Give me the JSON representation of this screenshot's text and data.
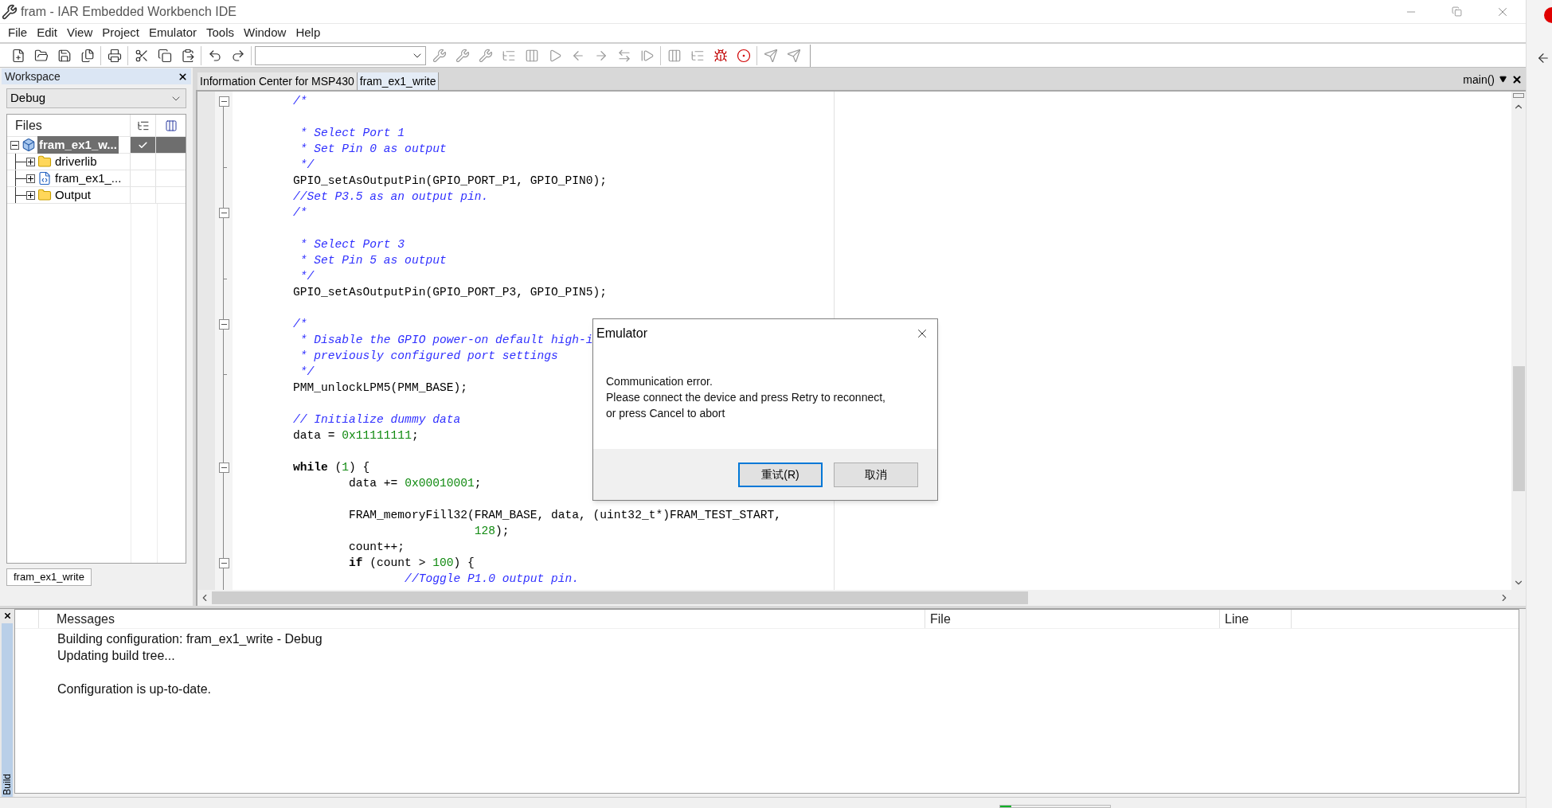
{
  "window": {
    "title": "fram - IAR Embedded Workbench IDE"
  },
  "menu": [
    "File",
    "Edit",
    "View",
    "Project",
    "Emulator",
    "Tools",
    "Window",
    "Help"
  ],
  "workspace": {
    "title": "Workspace",
    "configuration": "Debug",
    "files_header": "Files",
    "tree": [
      {
        "label": "fram_ex1_w...",
        "kind": "project",
        "selected": true,
        "checked": true,
        "expanded": true,
        "children": [
          {
            "label": "driverlib",
            "kind": "folder",
            "selected": false,
            "checked": false,
            "expanded": false
          },
          {
            "label": "fram_ex1_...",
            "kind": "cfile",
            "selected": false,
            "checked": false,
            "expanded": false
          },
          {
            "label": "Output",
            "kind": "folder",
            "selected": false,
            "checked": false,
            "expanded": false
          }
        ]
      }
    ],
    "bottom_tab": "fram_ex1_write"
  },
  "editor": {
    "tabs": [
      {
        "label": "Information Center for MSP430",
        "selected": false
      },
      {
        "label": "fram_ex1_write",
        "selected": true
      }
    ],
    "function": "main()",
    "lines": [
      {
        "kind": "fold_start",
        "segments": [
          {
            "kind": "comment",
            "text": "/*"
          }
        ]
      },
      {
        "kind": "plain"
      },
      {
        "kind": "plain",
        "segments": [
          {
            "kind": "comment",
            "text": " * Select Port 1"
          }
        ]
      },
      {
        "kind": "plain",
        "segments": [
          {
            "kind": "comment",
            "text": " * Set Pin 0 as output"
          }
        ]
      },
      {
        "kind": "fold_end",
        "segments": [
          {
            "kind": "comment",
            "text": " */"
          }
        ]
      },
      {
        "kind": "plain",
        "segments": [
          {
            "kind": "code",
            "text": "GPIO_setAsOutputPin(GPIO_PORT_P1, GPIO_PIN0);"
          }
        ]
      },
      {
        "kind": "plain",
        "segments": [
          {
            "kind": "comment",
            "text": "//Set P3.5 as an output pin."
          }
        ]
      },
      {
        "kind": "fold_start",
        "segments": [
          {
            "kind": "comment",
            "text": "/*"
          }
        ]
      },
      {
        "kind": "plain"
      },
      {
        "kind": "plain",
        "segments": [
          {
            "kind": "comment",
            "text": " * Select Port 3"
          }
        ]
      },
      {
        "kind": "plain",
        "segments": [
          {
            "kind": "comment",
            "text": " * Set Pin 5 as output"
          }
        ]
      },
      {
        "kind": "fold_end",
        "segments": [
          {
            "kind": "comment",
            "text": " */"
          }
        ]
      },
      {
        "kind": "plain",
        "segments": [
          {
            "kind": "code",
            "text": "GPIO_setAsOutputPin(GPIO_PORT_P3, GPIO_PIN5);"
          }
        ]
      },
      {
        "kind": "plain"
      },
      {
        "kind": "fold_start",
        "segments": [
          {
            "kind": "comment",
            "text": "/*"
          }
        ]
      },
      {
        "kind": "plain",
        "segments": [
          {
            "kind": "comment",
            "text": " * Disable the GPIO power-on default high-i"
          }
        ]
      },
      {
        "kind": "plain",
        "segments": [
          {
            "kind": "comment",
            "text": " * previously configured port settings"
          }
        ]
      },
      {
        "kind": "fold_end",
        "segments": [
          {
            "kind": "comment",
            "text": " */"
          }
        ]
      },
      {
        "kind": "plain",
        "segments": [
          {
            "kind": "code",
            "text": "PMM_unlockLPM5(PMM_BASE);"
          }
        ]
      },
      {
        "kind": "plain"
      },
      {
        "kind": "plain",
        "segments": [
          {
            "kind": "comment",
            "text": "// Initialize dummy data"
          }
        ]
      },
      {
        "kind": "plain",
        "segments": [
          {
            "kind": "code",
            "text": "data = "
          },
          {
            "kind": "number",
            "text": "0x11111111"
          },
          {
            "kind": "code",
            "text": ";"
          }
        ]
      },
      {
        "kind": "plain"
      },
      {
        "kind": "fold_start",
        "segments": [
          {
            "kind": "keyword",
            "text": "while"
          },
          {
            "kind": "code",
            "text": " ("
          },
          {
            "kind": "number",
            "text": "1"
          },
          {
            "kind": "code",
            "text": ") {"
          }
        ]
      },
      {
        "kind": "plain",
        "segments": [
          {
            "kind": "code",
            "text": "        data += "
          },
          {
            "kind": "number",
            "text": "0x00010001"
          },
          {
            "kind": "code",
            "text": ";"
          }
        ]
      },
      {
        "kind": "plain"
      },
      {
        "kind": "plain",
        "segments": [
          {
            "kind": "code",
            "text": "        FRAM_memoryFill32(FRAM_BASE, data, (uint32_t*)FRAM_TEST_START,"
          }
        ]
      },
      {
        "kind": "plain",
        "segments": [
          {
            "kind": "number",
            "text": "                          128"
          },
          {
            "kind": "code",
            "text": ");"
          }
        ]
      },
      {
        "kind": "plain",
        "segments": [
          {
            "kind": "code",
            "text": "        count++;"
          }
        ]
      },
      {
        "kind": "fold_start",
        "segments": [
          {
            "kind": "keyword",
            "text": "        if"
          },
          {
            "kind": "code",
            "text": " (count > "
          },
          {
            "kind": "number",
            "text": "100"
          },
          {
            "kind": "code",
            "text": ") {"
          }
        ]
      },
      {
        "kind": "plain",
        "segments": [
          {
            "kind": "comment",
            "text": "                //Toggle P1.0 output pin."
          }
        ]
      }
    ]
  },
  "dialog": {
    "title": "Emulator",
    "message_lines": [
      "Communication error.",
      "Please connect the device and press Retry to reconnect,",
      "or press Cancel to abort"
    ],
    "buttons": [
      {
        "label": "重试(R)",
        "default": true
      },
      {
        "label": "取消",
        "default": false
      }
    ]
  },
  "build": {
    "tab": "Build",
    "columns": [
      "Messages",
      "File",
      "Line"
    ],
    "rows": [
      {
        "text": "Building configuration: fram_ex1_write - Debug"
      },
      {
        "text": "Updating build tree..."
      },
      {},
      {
        "text": "Configuration is up-to-date."
      }
    ]
  },
  "status_bar": {
    "progress": {
      "level": 0.1
    }
  }
}
